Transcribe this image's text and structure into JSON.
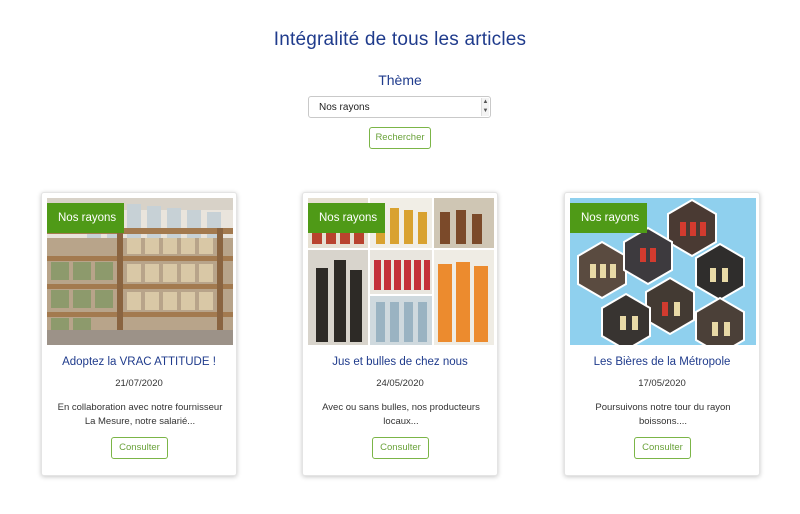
{
  "header": {
    "title": "Intégralité de tous les articles",
    "theme_label": "Thème",
    "theme_select_value": "Nos rayons",
    "search_button": "Rechercher"
  },
  "cards": [
    {
      "badge": "Nos rayons",
      "title": "Adoptez la VRAC ATTITUDE !",
      "date": "21/07/2020",
      "excerpt": "En collaboration avec notre fournisseur La Mesure, notre salarié...",
      "button": "Consulter"
    },
    {
      "badge": "Nos rayons",
      "title": "Jus et bulles de chez nous",
      "date": "24/05/2020",
      "excerpt": "Avec ou sans bulles, nos producteurs locaux...",
      "button": "Consulter"
    },
    {
      "badge": "Nos rayons",
      "title": "Les Bières de la Métropole",
      "date": "17/05/2020",
      "excerpt": "Poursuivons notre tour du rayon boissons....",
      "button": "Consulter"
    }
  ],
  "colors": {
    "title_blue": "#1f3b8c",
    "badge_green": "#4f9a17",
    "button_green": "#7bb547"
  }
}
